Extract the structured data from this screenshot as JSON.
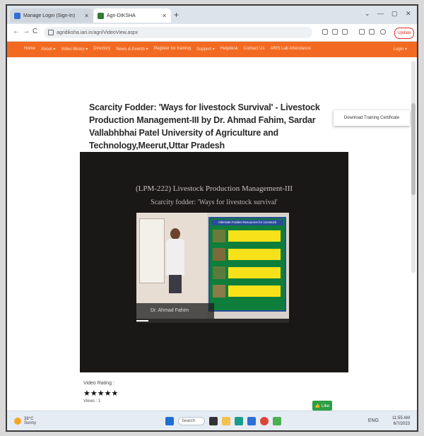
{
  "browser": {
    "tabs": [
      {
        "label": "Manage Login (Sign-In)",
        "favicon_color": "#2f6fd6"
      },
      {
        "label": "Agri-DIKSHA",
        "favicon_color": "#2e7d32"
      }
    ],
    "new_tab": "+",
    "window_controls": [
      "⌄",
      "—",
      "▢",
      "✕"
    ],
    "back": "←",
    "forward": "→",
    "reload": "C",
    "url": "agridiksha.iari.in/agri/VideoView.aspx",
    "update_label": "Update"
  },
  "site_nav": {
    "items": [
      "Home",
      "About ▾",
      "Video library ▾",
      "Directory",
      "News & Events ▾",
      "Register for training",
      "Support ▾",
      "Helpdesk",
      "Contact Us",
      "ARIS Lab Attendance"
    ],
    "login": "Login ▾",
    "bg_color": "#f26a21"
  },
  "page": {
    "title": "Scarcity Fodder: 'Ways for livestock Survival' - Livestock Production Management-III by Dr. Ahmad Fahim, Sardar Vallabhbhai Patel University of Agriculture and Technology,Meerut,Uttar Pradesh",
    "download_certificate": "Download Training Certificate",
    "video": {
      "heading_line1": "(LPM-222) Livestock Production Management-III",
      "heading_line2": "Scarcity fodder: 'Ways for livestock survival'",
      "slide_header": "Alternate Fodder Resources for Livestock",
      "presenter_caption": "Dr. Ahmad Fahim",
      "progress": 0.08
    },
    "rating_label": "Video Rating :",
    "stars": "★★★★★",
    "views": "Views : 1",
    "like_label": "👍 Like"
  },
  "taskbar": {
    "weather_temp": "38°C",
    "weather_desc": "Sunny",
    "search_label": "Search",
    "time": "11:55 AM",
    "date": "6/7/2023",
    "lang": "ENG"
  }
}
